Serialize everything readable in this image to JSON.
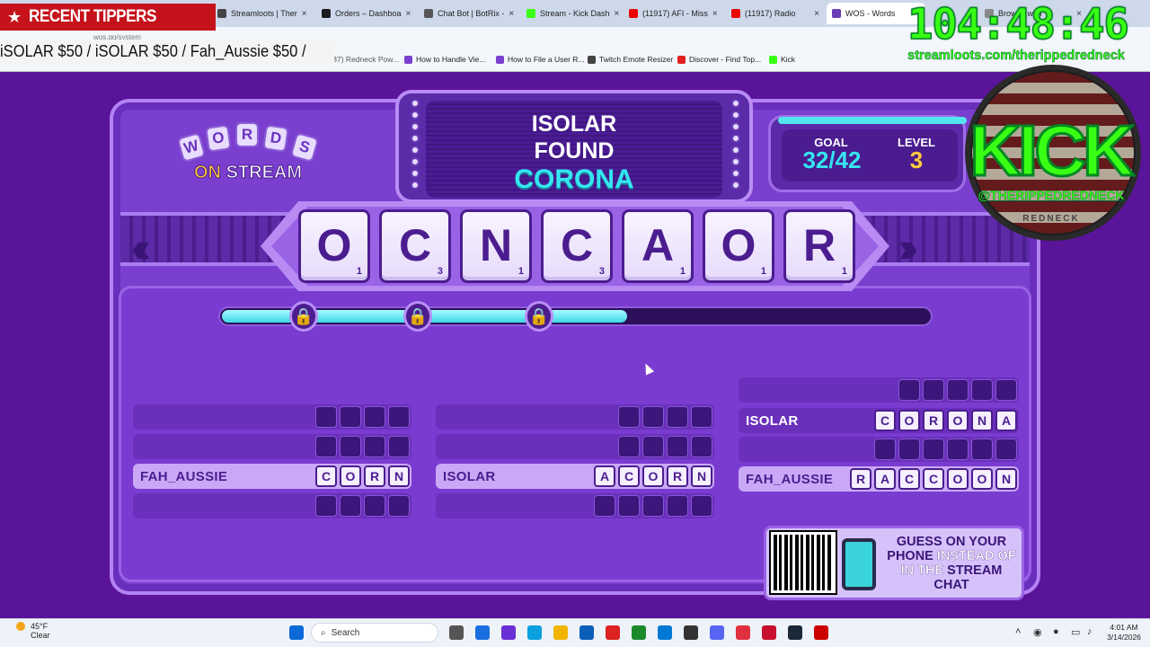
{
  "browser": {
    "tabs": [
      {
        "label": "",
        "color": "#888"
      },
      {
        "label": "Streamloots | Ther",
        "color": "#444"
      },
      {
        "label": "Orders – Dashboa",
        "color": "#1c1c1c"
      },
      {
        "label": "Chat Bot | BotRix -",
        "color": "#555"
      },
      {
        "label": "Stream - Kick Dash",
        "color": "#39ff14"
      },
      {
        "label": "(11917) AFI - Miss",
        "color": "#e00"
      },
      {
        "label": "(11917) Radio",
        "color": "#e00"
      },
      {
        "label": "WOS - Words",
        "color": "#6a3cb8"
      },
      {
        "label": "Browse with",
        "color": "#888"
      }
    ],
    "bookmarks": [
      {
        "label": "How to Handle Vie...",
        "color": "#7a3fce"
      },
      {
        "label": "How to File a User R...",
        "color": "#7a3fce"
      },
      {
        "label": "Twitch Emote Resizer",
        "color": "#444"
      },
      {
        "label": "Discover - Find Top...",
        "color": "#e02020"
      },
      {
        "label": "Kick",
        "color": "#39ff14"
      }
    ],
    "bookmarks_hidden_left": "(1837) Redneck Pow..."
  },
  "overlay": {
    "recent_tippers_label": "RECENT TIPPERS",
    "ticker_text": "iSOLAR $50 / iSOLAR $50 / Fah_Aussie $50 /",
    "ticker_url": "wos.gg/system",
    "timer": "104:48:46",
    "promo_url": "streamloots.com/therippedredneck",
    "kick_logo_text": "KICK",
    "kick_handle": "@THERIPPEDREDNECK",
    "kick_sub": "REDNECK"
  },
  "game": {
    "logo_top": [
      "W",
      "O",
      "R",
      "D",
      "S"
    ],
    "logo_on": "ON",
    "logo_stream": "STREAM",
    "marquee": {
      "line1": "ISOLAR",
      "line2": "FOUND",
      "line3": "CORONA"
    },
    "goal_label": "GOAL",
    "goal_value": "32/42",
    "level_label": "LEVEL",
    "level_value": "3",
    "letters": [
      {
        "ch": "O",
        "pts": "1"
      },
      {
        "ch": "C",
        "pts": "3"
      },
      {
        "ch": "N",
        "pts": "1"
      },
      {
        "ch": "C",
        "pts": "3"
      },
      {
        "ch": "A",
        "pts": "1"
      },
      {
        "ch": "O",
        "pts": "1"
      },
      {
        "ch": "R",
        "pts": "1"
      }
    ],
    "progress_fraction": 0.57,
    "locks_unlocked": 3,
    "columns": [
      {
        "rows": [
          {
            "name": "",
            "letters": [
              "",
              "",
              "",
              ""
            ],
            "found": false
          },
          {
            "name": "",
            "letters": [
              "",
              "",
              "",
              ""
            ],
            "found": false
          },
          {
            "name": "FAH_AUSSIE",
            "letters": [
              "C",
              "O",
              "R",
              "N"
            ],
            "found": true
          },
          {
            "name": "",
            "letters": [
              "",
              "",
              "",
              ""
            ],
            "found": false
          }
        ]
      },
      {
        "rows": [
          {
            "name": "",
            "letters": [
              "",
              "",
              "",
              ""
            ],
            "found": false
          },
          {
            "name": "",
            "letters": [
              "",
              "",
              "",
              ""
            ],
            "found": false
          },
          {
            "name": "ISOLAR",
            "letters": [
              "A",
              "C",
              "O",
              "R",
              "N"
            ],
            "found": true
          },
          {
            "name": "",
            "letters": [
              "",
              "",
              "",
              "",
              ""
            ],
            "found": false
          }
        ]
      },
      {
        "rows": [
          {
            "name": "",
            "letters": [
              "",
              "",
              "",
              "",
              ""
            ],
            "found": false
          },
          {
            "name": "ISOLAR",
            "letters": [
              "C",
              "O",
              "R",
              "O",
              "N",
              "A"
            ],
            "found": true
          },
          {
            "name": "",
            "letters": [
              "",
              "",
              "",
              "",
              "",
              ""
            ],
            "found": false
          },
          {
            "name": "FAH_AUSSIE",
            "letters": [
              "R",
              "A",
              "C",
              "C",
              "O",
              "O",
              "N"
            ],
            "found": true
          }
        ]
      }
    ],
    "qr_text": {
      "a": "GUESS ON YOUR PHONE",
      "b": "INSTEAD OF IN THE",
      "c": "STREAM CHAT"
    }
  },
  "taskbar": {
    "weather_temp": "45°F",
    "weather_desc": "Clear",
    "search_placeholder": "Search",
    "time": "4:01 AM",
    "date": "3/14/2026"
  }
}
